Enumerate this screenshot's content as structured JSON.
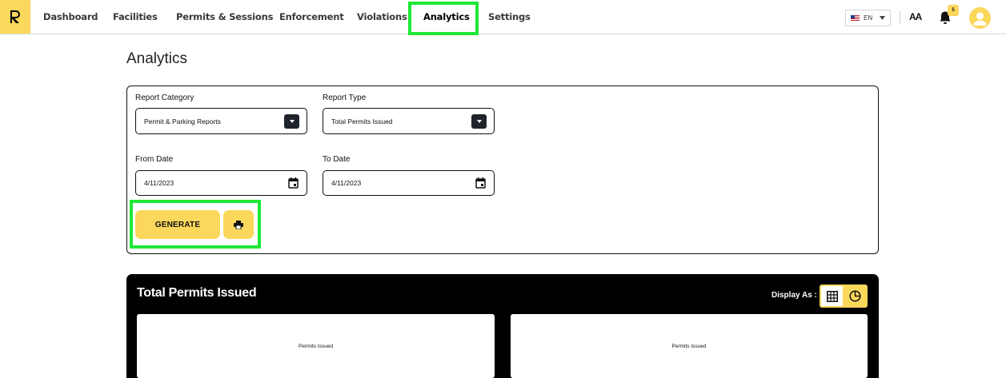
{
  "nav": {
    "items": [
      {
        "label": "Dashboard"
      },
      {
        "label": "Facilities"
      },
      {
        "label": "Permits & Sessions"
      },
      {
        "label": "Enforcement"
      },
      {
        "label": "Violations"
      },
      {
        "label": "Analytics",
        "active": true
      },
      {
        "label": "Settings"
      }
    ],
    "language": "EN",
    "font_size_label": "AA",
    "notification_count": "5",
    "accent_color": "#fbd75b",
    "highlight_color": "#1ee836"
  },
  "page": {
    "title": "Analytics"
  },
  "form": {
    "report_category_label": "Report Category",
    "report_category_value": "Permit & Parking Reports",
    "report_type_label": "Report Type",
    "report_type_value": "Total Permits Issued",
    "from_date_label": "From Date",
    "from_date_value": "4/11/2023",
    "to_date_label": "To Date",
    "to_date_value": "4/11/2023",
    "generate_label": "GENERATE",
    "print_icon": "printer-icon"
  },
  "report": {
    "title": "Total Permits Issued",
    "display_as_label": "Display As :",
    "views": [
      "table-icon",
      "pie-chart-icon"
    ],
    "charts": [
      {
        "title": "Permits Issued"
      },
      {
        "title": "Permits Issued"
      }
    ]
  }
}
